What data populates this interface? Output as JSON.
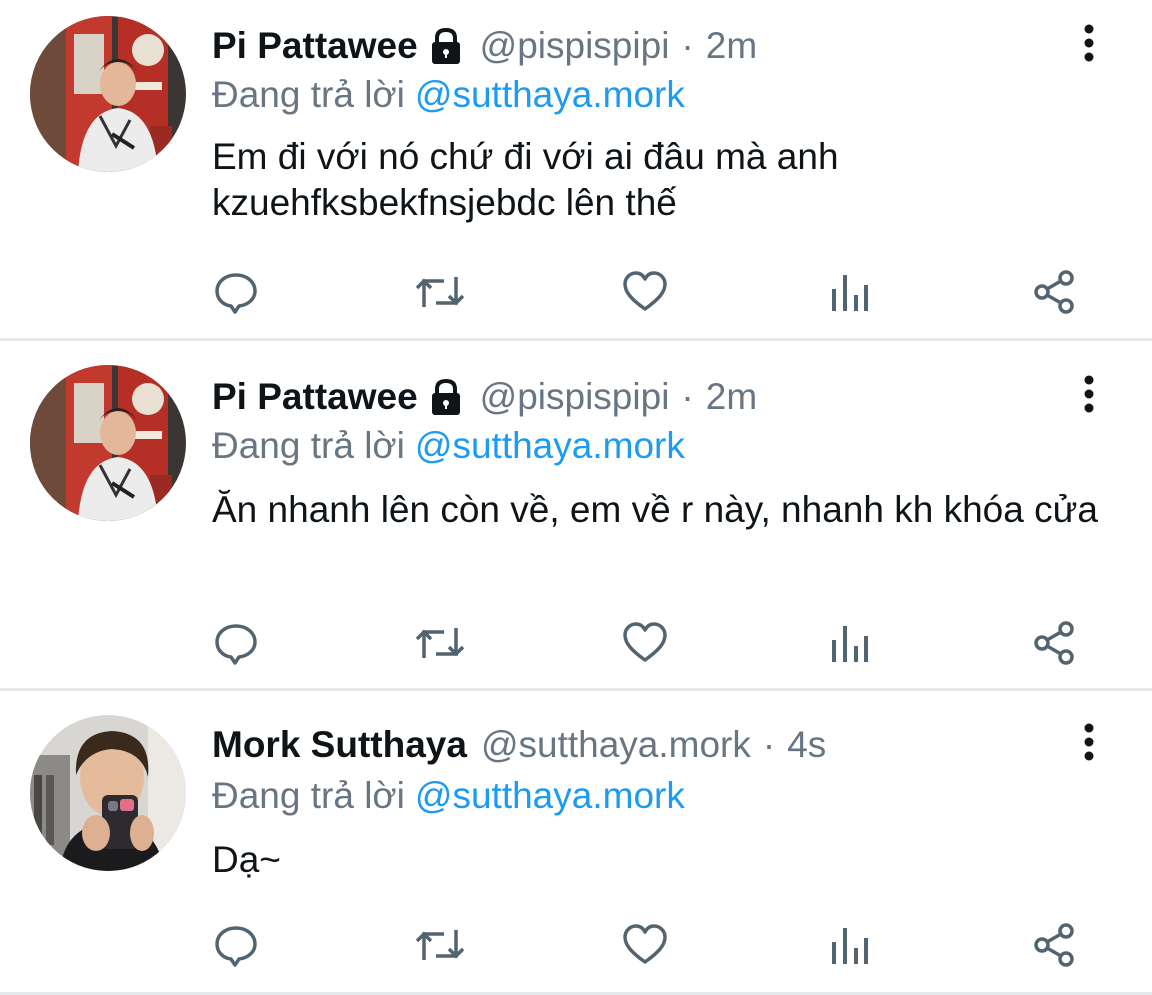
{
  "colors": {
    "link": "#1d9bf0",
    "secondary_text": "#687684",
    "primary_text": "#0f1419",
    "divider": "#e6e9ec"
  },
  "tweets": [
    {
      "display_name": "Pi Pattawee",
      "protected_icon": "lock-icon",
      "handle": "@pispispipi",
      "separator": "·",
      "time": "2m",
      "reply_prefix": "Đang trả lời",
      "reply_to": "@sutthaya.mork",
      "text": "Em đi với nó chứ đi với ai đâu mà anh kzuehfksbekfnsjebdc lên thế"
    },
    {
      "display_name": "Pi Pattawee",
      "protected_icon": "lock-icon",
      "handle": "@pispispipi",
      "separator": "·",
      "time": "2m",
      "reply_prefix": "Đang trả lời",
      "reply_to": "@sutthaya.mork",
      "text": "Ăn nhanh lên còn về, em về r này, nhanh kh khóa cửa"
    },
    {
      "display_name": "Mork Sutthaya",
      "handle": "@sutthaya.mork",
      "separator": "·",
      "time": "4s",
      "reply_prefix": "Đang trả lời",
      "reply_to": "@sutthaya.mork",
      "text": "Dạ~"
    }
  ],
  "action_icons": [
    "reply-icon",
    "retweet-icon",
    "like-icon",
    "stats-icon",
    "share-icon"
  ]
}
